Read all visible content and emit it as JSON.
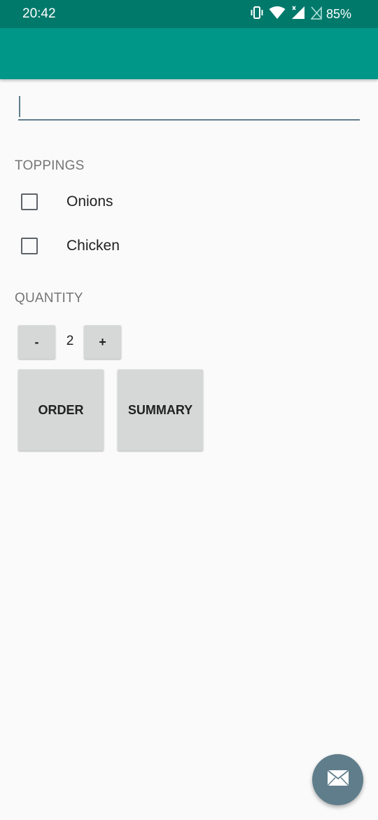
{
  "status_bar": {
    "time": "20:42",
    "battery": "85%",
    "icons": [
      "vibrate-icon",
      "wifi-icon",
      "signal-icon",
      "no-sim-icon"
    ]
  },
  "name_input": {
    "value": "",
    "placeholder": ""
  },
  "toppings": {
    "header": "TOPPINGS",
    "items": [
      {
        "label": "Onions",
        "checked": false
      },
      {
        "label": "Chicken",
        "checked": false
      }
    ]
  },
  "quantity": {
    "header": "QUANTITY",
    "decrement_label": "-",
    "value": "2",
    "increment_label": "+"
  },
  "actions": {
    "order_label": "ORDER",
    "summary_label": "SUMMARY"
  },
  "fab": {
    "icon": "email-icon"
  },
  "colors": {
    "status_bar": "#00796b",
    "app_bar": "#009688",
    "accent": "#607d8b",
    "button_bg": "#d6d7d7",
    "background": "#fafafa"
  }
}
